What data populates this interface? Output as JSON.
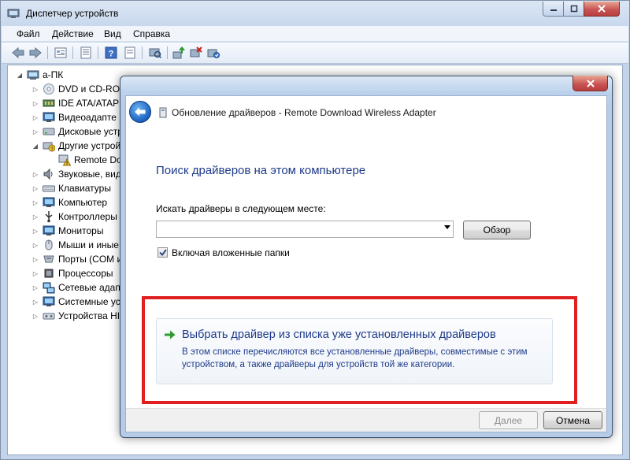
{
  "window": {
    "title": "Диспетчер устройств"
  },
  "menu": [
    "Файл",
    "Действие",
    "Вид",
    "Справка"
  ],
  "toolbar_icons": [
    "back-icon",
    "forward-icon",
    "properties-icon",
    "list-view-icon",
    "help-icon",
    "show-hidden-icon",
    "update-driver-icon",
    "disable-device-icon",
    "enable-device-icon"
  ],
  "tree": {
    "root": "a-ПК",
    "items": [
      "DVD и CD-ROM",
      "IDE ATA/ATAP",
      "Видеоадапте",
      "Дисковые устр",
      "Другие устрой",
      "Remote Do",
      "Звуковые, вид",
      "Клавиатуры",
      "Компьютер",
      "Контроллеры",
      "Мониторы",
      "Мыши и иные",
      "Порты (COM и",
      "Процессоры",
      "Сетевые адап",
      "Системные ус",
      "Устройства HI"
    ]
  },
  "dialog": {
    "title": "Обновление драйверов - Remote Download Wireless Adapter",
    "heading": "Поиск драйверов на этом компьютере",
    "search_label": "Искать драйверы в следующем месте:",
    "path_value": "",
    "browse_label": "Обзор",
    "subfolders_label": "Включая вложенные папки",
    "subfolders_checked": true,
    "choose_title": "Выбрать драйвер из списка уже установленных драйверов",
    "choose_desc": "В этом списке перечисляются все установленные драйверы, совместимые с этим устройством, а также драйверы для устройств той же категории.",
    "next_label": "Далее",
    "cancel_label": "Отмена"
  },
  "colors": {
    "link_blue": "#1e3b8a",
    "highlight_red": "#e02020",
    "arrow_green": "#2f9b2f"
  }
}
